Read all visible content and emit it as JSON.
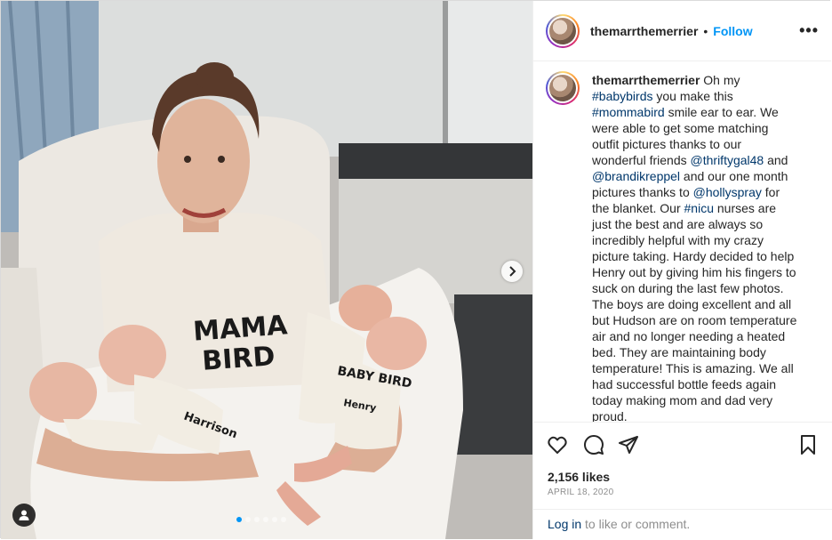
{
  "post": {
    "username": "themarrthemerrier",
    "separator": "•",
    "follow_label": "Follow",
    "more_icon": "more-horizontal-icon",
    "more_label": "•••",
    "photo": {
      "shirt_text_line1": "MAMA",
      "shirt_text_line2": "BIRD",
      "baby_shirt_text_a": "BABY BIRD",
      "baby_shirt_text_b": "Harrison",
      "baby_shirt_text_c": "Henry",
      "carousel_dots": 6,
      "carousel_active_index": 0
    },
    "caption": {
      "username": "themarrthemerrier",
      "segments": [
        {
          "text": " Oh my ",
          "type": "text"
        },
        {
          "text": "#babybirds",
          "type": "tag"
        },
        {
          "text": " you make this ",
          "type": "text"
        },
        {
          "text": "#mommabird",
          "type": "tag"
        },
        {
          "text": " smile ear to ear. We were able to get some matching outfit pictures thanks to our wonderful friends ",
          "type": "text"
        },
        {
          "text": "@thriftygal48",
          "type": "tag"
        },
        {
          "text": " and ",
          "type": "text"
        },
        {
          "text": "@brandikreppel",
          "type": "tag"
        },
        {
          "text": " and our one month pictures thanks to ",
          "type": "text"
        },
        {
          "text": "@hollyspray",
          "type": "tag"
        },
        {
          "text": " for the blanket. Our ",
          "type": "text"
        },
        {
          "text": "#nicu",
          "type": "tag"
        },
        {
          "text": " nurses are just the best and are always so incredibly helpful with my crazy picture taking. Hardy decided to help Henry out by giving him his fingers to suck on during the last few photos. The boys are doing excellent and all but Hudson are on room temperature air and no longer needing a heated bed. They are maintaining body temperature! This is amazing. We all had successful bottle feeds again today making mom and dad very proud.",
          "type": "text"
        }
      ]
    },
    "likes": "2,156 likes",
    "date": "APRIL 18, 2020",
    "login": {
      "link": "Log in",
      "rest": " to like or comment."
    },
    "icons": {
      "like": "heart-icon",
      "comment": "comment-icon",
      "share": "send-icon",
      "save": "bookmark-icon",
      "next": "chevron-right-icon",
      "tags": "user-tag-icon"
    },
    "colors": {
      "accent": "#0095f6",
      "link": "#00376b",
      "text": "#262626",
      "muted": "#8e8e8e"
    }
  }
}
